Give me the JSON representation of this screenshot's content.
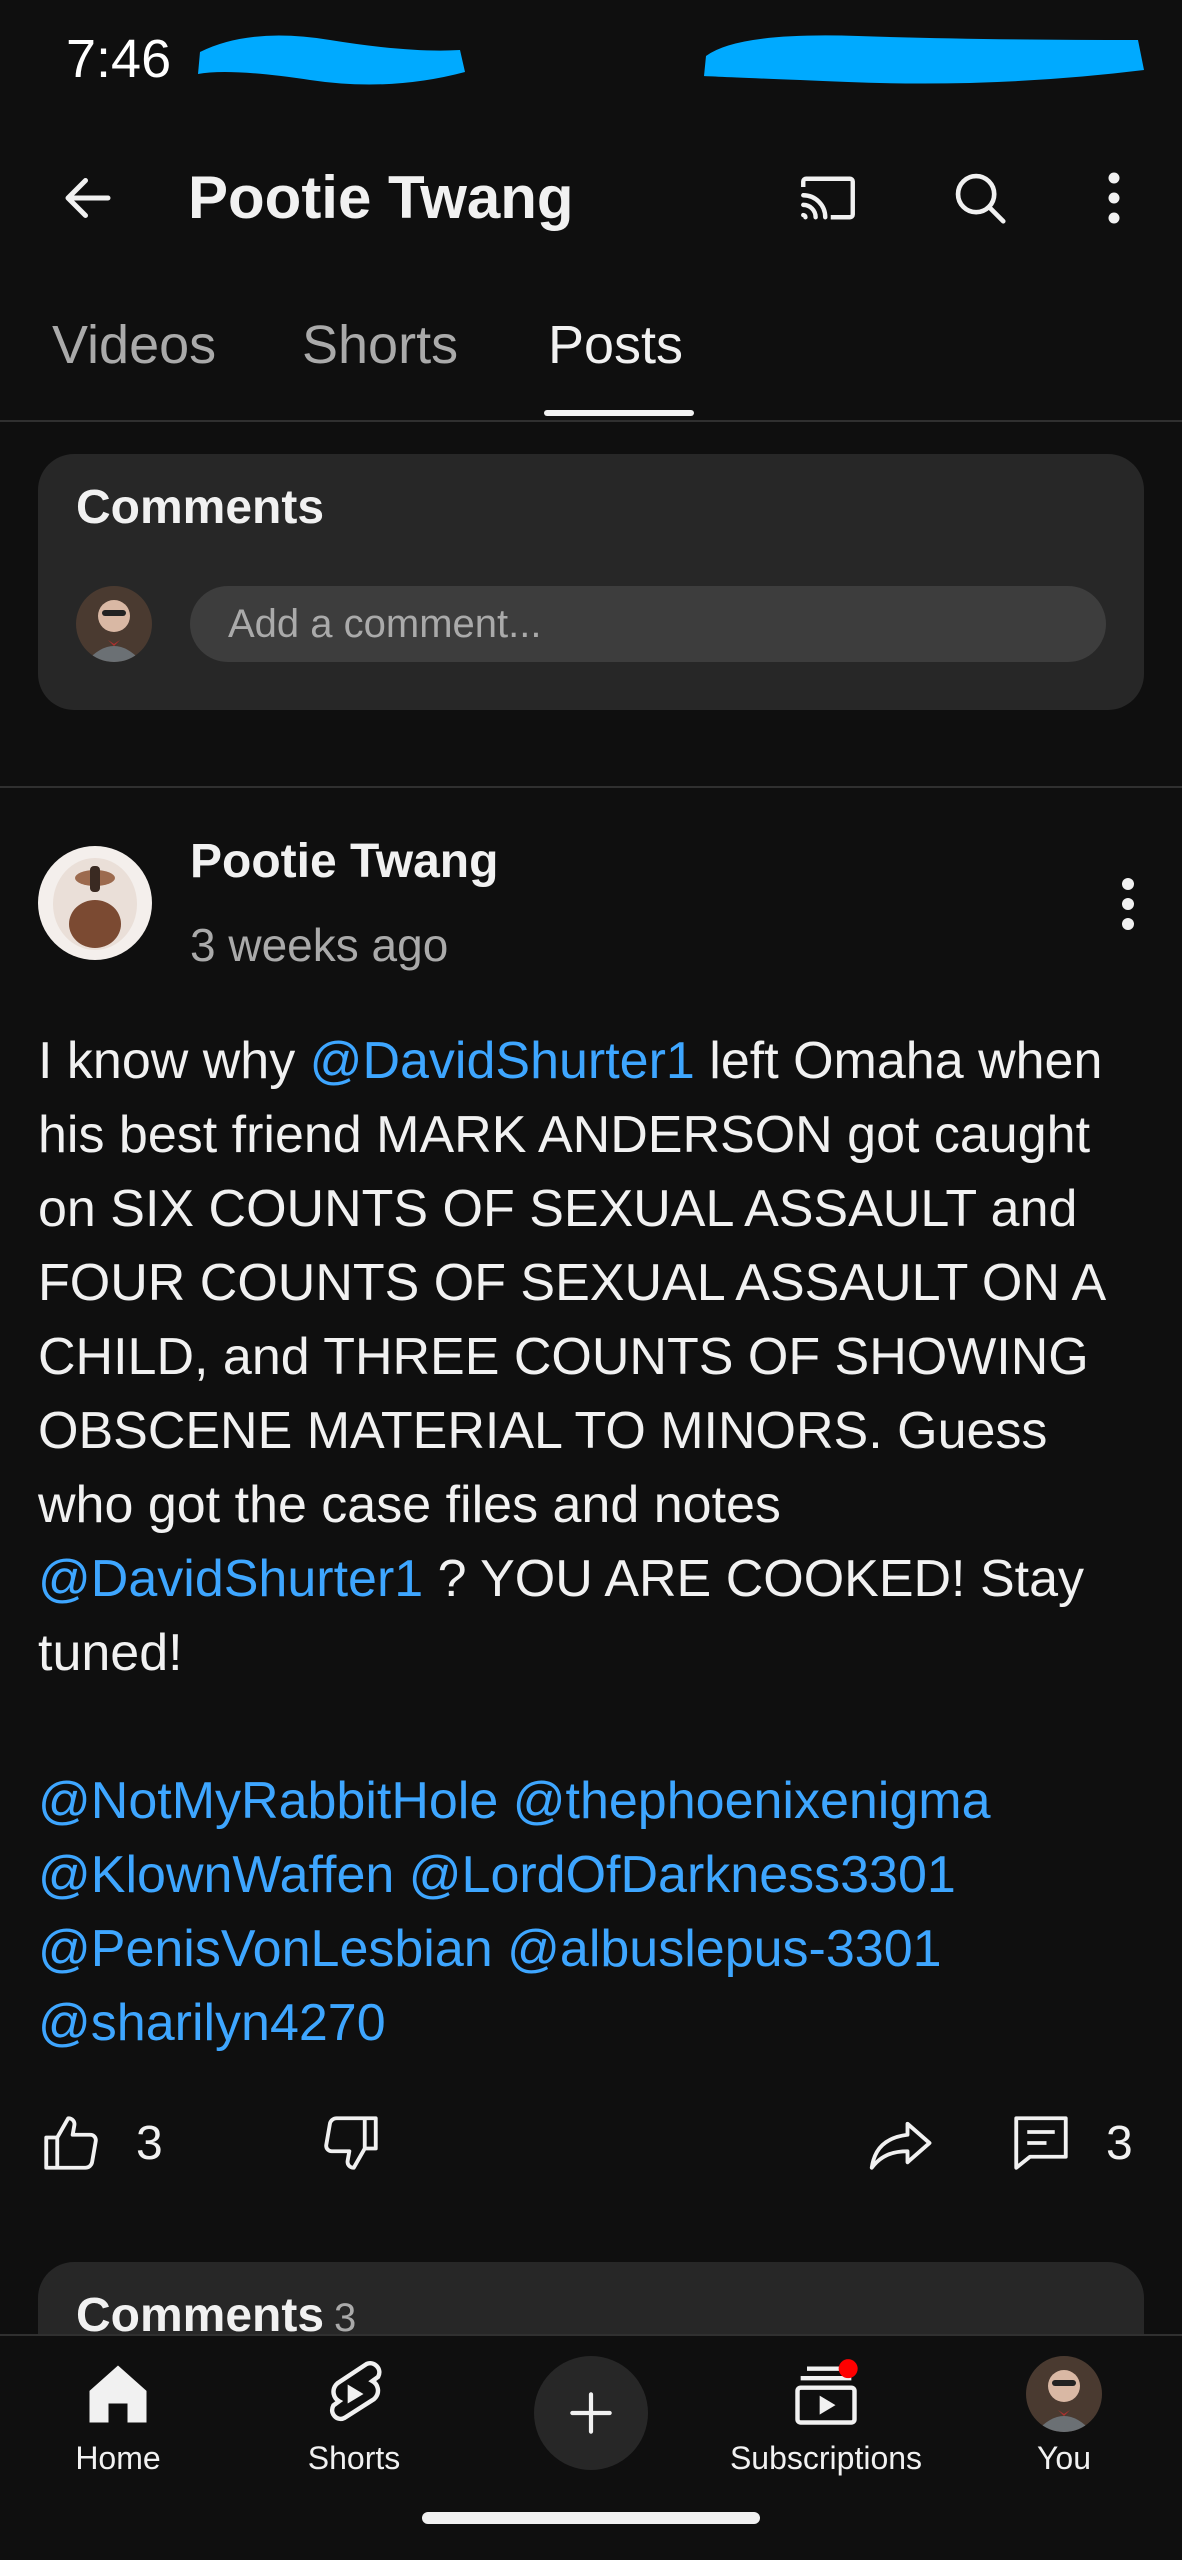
{
  "status": {
    "time": "7:46"
  },
  "header": {
    "channel_name": "Pootie Twang"
  },
  "tabs": [
    {
      "label": "Videos"
    },
    {
      "label": "Shorts"
    },
    {
      "label": "Posts",
      "active": true
    }
  ],
  "comment_box": {
    "title": "Comments",
    "placeholder": "Add a comment..."
  },
  "post": {
    "author": "Pootie Twang",
    "time": "3 weeks ago",
    "body": {
      "p1": "I know why ",
      "m1": "@DavidShurter1",
      "p2": " left Omaha when his best friend MARK ANDERSON got caught on SIX COUNTS OF SEXUAL ASSAULT and FOUR COUNTS OF SEXUAL ASSAULT ON A CHILD, and THREE COUNTS OF SHOWING OBSCENE MATERIAL TO MINORS. Guess who got the case files and notes ",
      "m2": "@DavidShurter1",
      "p3": " ? YOU ARE COOKED! Stay tuned!"
    },
    "mentions": [
      "@NotMyRabbitHole",
      "@thephoenixenigma",
      "@KlownWaffen",
      "@LordOfDarkness3301",
      "@PenisVonLesbian",
      "@albuslepus-3301",
      "@sharilyn4270"
    ],
    "likes": "3",
    "comments_count": "3"
  },
  "comments_preview": {
    "title": "Comments",
    "count": "3"
  },
  "bottom_nav": {
    "home": "Home",
    "shorts": "Shorts",
    "subscriptions": "Subscriptions",
    "you": "You"
  },
  "colors": {
    "background": "#0f0f0f",
    "card": "#272727",
    "mention": "#3ea6ff",
    "redaction": "#00aaff",
    "notification_dot": "#ff0000"
  }
}
